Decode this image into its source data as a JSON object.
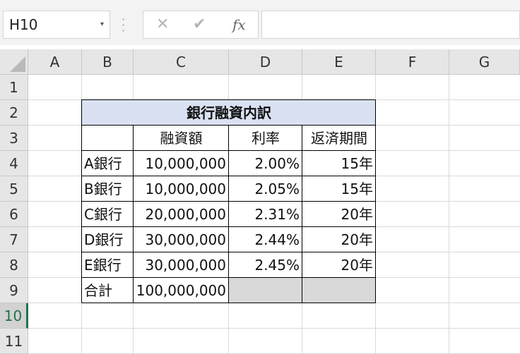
{
  "formula_bar": {
    "name_box": "H10",
    "cancel_icon": "✕",
    "enter_icon": "✔",
    "fx_label": "fx",
    "formula": ""
  },
  "columns": [
    "A",
    "B",
    "C",
    "D",
    "E",
    "F",
    "G"
  ],
  "rows": [
    "1",
    "2",
    "3",
    "4",
    "5",
    "6",
    "7",
    "8",
    "9",
    "10",
    "11"
  ],
  "selected_row": "10",
  "table": {
    "title": "銀行融資内訳",
    "headers": [
      "",
      "融資額",
      "利率",
      "返済期間"
    ],
    "data": [
      [
        "A銀行",
        "10,000,000",
        "2.00%",
        "15年"
      ],
      [
        "B銀行",
        "10,000,000",
        "2.05%",
        "15年"
      ],
      [
        "C銀行",
        "20,000,000",
        "2.31%",
        "20年"
      ],
      [
        "D銀行",
        "30,000,000",
        "2.44%",
        "20年"
      ],
      [
        "E銀行",
        "30,000,000",
        "2.45%",
        "20年"
      ]
    ],
    "total": [
      "合計",
      "100,000,000",
      "",
      ""
    ]
  }
}
